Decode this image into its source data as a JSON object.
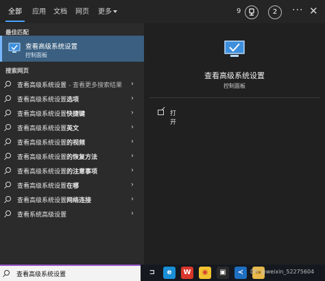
{
  "tabs": [
    "全部",
    "应用",
    "文档",
    "网页",
    "更多"
  ],
  "header": {
    "rewards_count": "9",
    "account_badge": "2",
    "more": "···",
    "close": "✕"
  },
  "best_match": {
    "section_label": "最佳匹配",
    "title": "查看高级系统设置",
    "subtitle": "控制面板"
  },
  "web_section": {
    "label": "搜索网页",
    "items": [
      {
        "main": "查看高级系统设置",
        "hint": " - 查看更多搜索结果"
      },
      {
        "main": "查看高级系统设置",
        "bold": "选项"
      },
      {
        "main": "查看高级系统设置",
        "bold": "快捷键"
      },
      {
        "main": "查看高级系统设置",
        "bold": "英文"
      },
      {
        "main": "查看高级系统设置",
        "bold": "的视频"
      },
      {
        "main": "查看高级系统设置",
        "bold": "的恢复方法"
      },
      {
        "main": "查看高级系统设置",
        "bold": "的注意事项"
      },
      {
        "main": "查看高级系统设置",
        "bold": "在哪"
      },
      {
        "main": "查看高级系统设置",
        "bold": "网络连接"
      },
      {
        "main": "查看系统高级设置"
      }
    ]
  },
  "preview": {
    "title": "查看高级系统设置",
    "subtitle": "控制面板",
    "open_label": "打开"
  },
  "taskbar": {
    "search_value": "查看高级系统设置",
    "tray_text": "DN @weixin_52275604",
    "apps": [
      {
        "icon": "task-view-icon",
        "glyph": "⊐",
        "bg": "#15191f",
        "fg": "#e0e0e0"
      },
      {
        "icon": "edge-icon",
        "glyph": "e",
        "bg": "#1a8fd6",
        "fg": "#ffffff"
      },
      {
        "icon": "wps-icon",
        "glyph": "W",
        "bg": "#d9362b",
        "fg": "#ffffff"
      },
      {
        "icon": "chrome-icon",
        "glyph": "◉",
        "bg": "#f2c230",
        "fg": "#d23b2f"
      },
      {
        "icon": "app-icon",
        "glyph": "▣",
        "bg": "#2a2a2a",
        "fg": "#ffffff"
      },
      {
        "icon": "vscode-icon",
        "glyph": "≺",
        "bg": "#1f6fc1",
        "fg": "#ffffff"
      },
      {
        "icon": "folder-icon",
        "glyph": "▬",
        "bg": "#e8b84a",
        "fg": "#b37b10"
      }
    ]
  },
  "colors": {
    "accent": "#4ea3ff",
    "highlight": "#3a5f80"
  }
}
